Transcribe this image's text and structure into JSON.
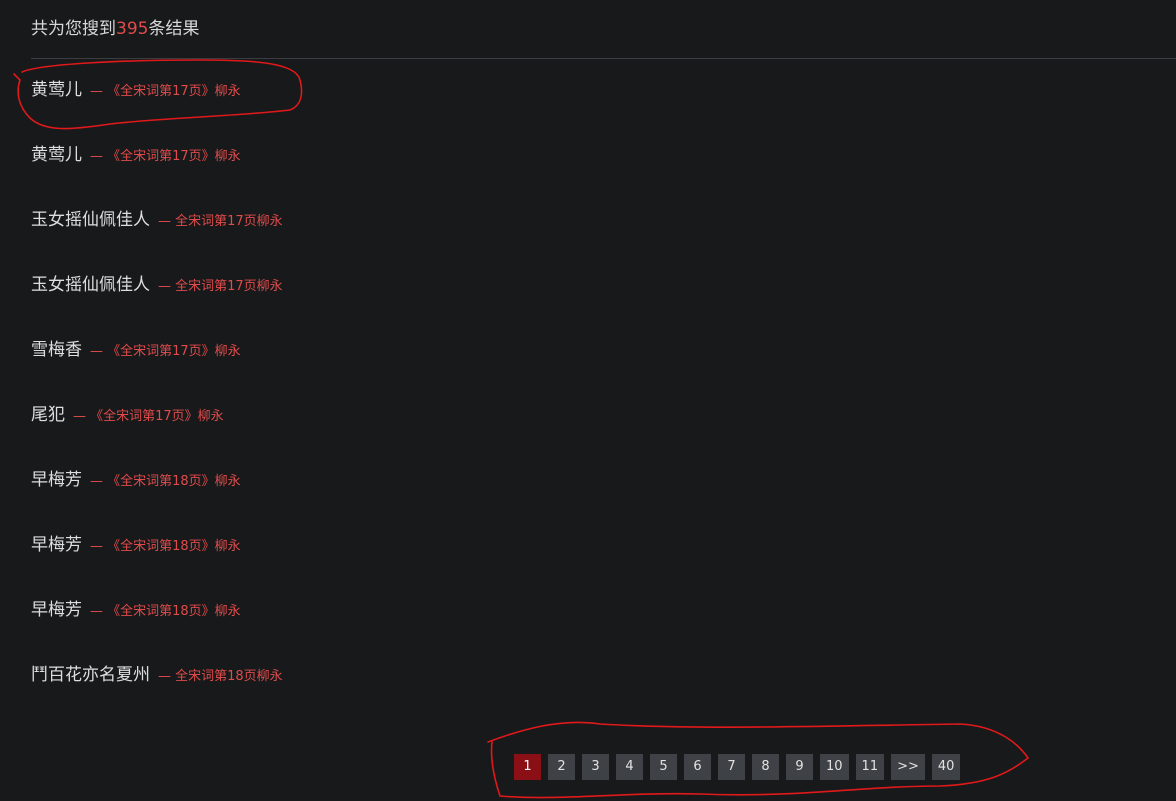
{
  "summary": {
    "prefix": "共为您搜到",
    "count": "395",
    "suffix": "条结果"
  },
  "results": [
    {
      "title": "黄莺儿",
      "source": "— 《全宋词第17页》柳永"
    },
    {
      "title": "黄莺儿",
      "source": "— 《全宋词第17页》柳永"
    },
    {
      "title": "玉女摇仙佩佳人",
      "source": "— 全宋词第17页柳永"
    },
    {
      "title": "玉女摇仙佩佳人",
      "source": "— 全宋词第17页柳永"
    },
    {
      "title": "雪梅香",
      "source": "— 《全宋词第17页》柳永"
    },
    {
      "title": "尾犯",
      "source": "— 《全宋词第17页》柳永"
    },
    {
      "title": "早梅芳",
      "source": "— 《全宋词第18页》柳永"
    },
    {
      "title": "早梅芳",
      "source": "— 《全宋词第18页》柳永"
    },
    {
      "title": "早梅芳",
      "source": "— 《全宋词第18页》柳永"
    },
    {
      "title": "鬥百花亦名夏州",
      "source": "— 全宋词第18页柳永"
    }
  ],
  "pagination": {
    "current": "1",
    "pages": [
      "1",
      "2",
      "3",
      "4",
      "5",
      "6",
      "7",
      "8",
      "9",
      "10",
      "11",
      ">>",
      "40"
    ]
  },
  "colors": {
    "background": "#18191b",
    "accent": "#e04b4b",
    "active_page": "#8b1016",
    "page_button": "#3e4246",
    "annotation": "#e0191b"
  }
}
